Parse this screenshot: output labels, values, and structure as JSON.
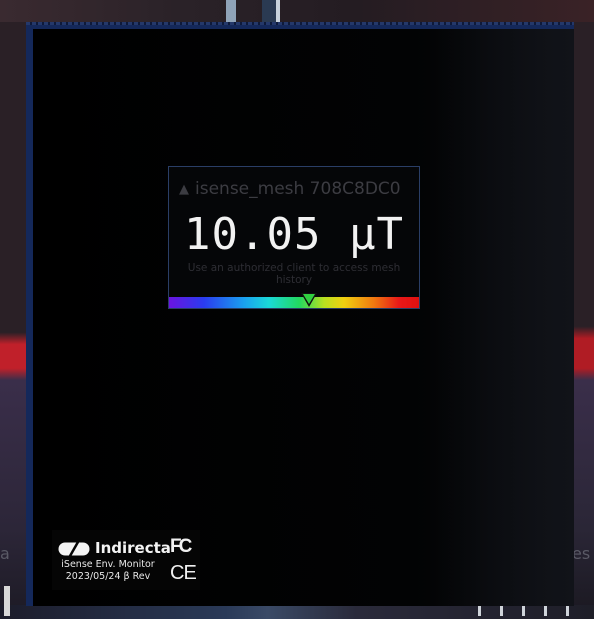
{
  "background": {
    "ghost_left": "a",
    "ghost_right": "es"
  },
  "sensor": {
    "arrow_icon": "triangle-up-icon",
    "name": "isense_mesh 708C8DC0",
    "value": "10.05 µT",
    "history_note": "Use an authorized client to access mesh history",
    "scale_level": 0.56
  },
  "brand": {
    "logo_icon": "pill-logo-icon",
    "name": "Indirecta",
    "model": "iSense Env. Monitor",
    "date_rev": "2023/05/24 β Rev",
    "fc_mark": "FC",
    "ce_mark": "CE"
  },
  "colors": {
    "frame_accent": "#14285a",
    "marker": "#30d040",
    "reading_text": "#f2f2f2"
  }
}
